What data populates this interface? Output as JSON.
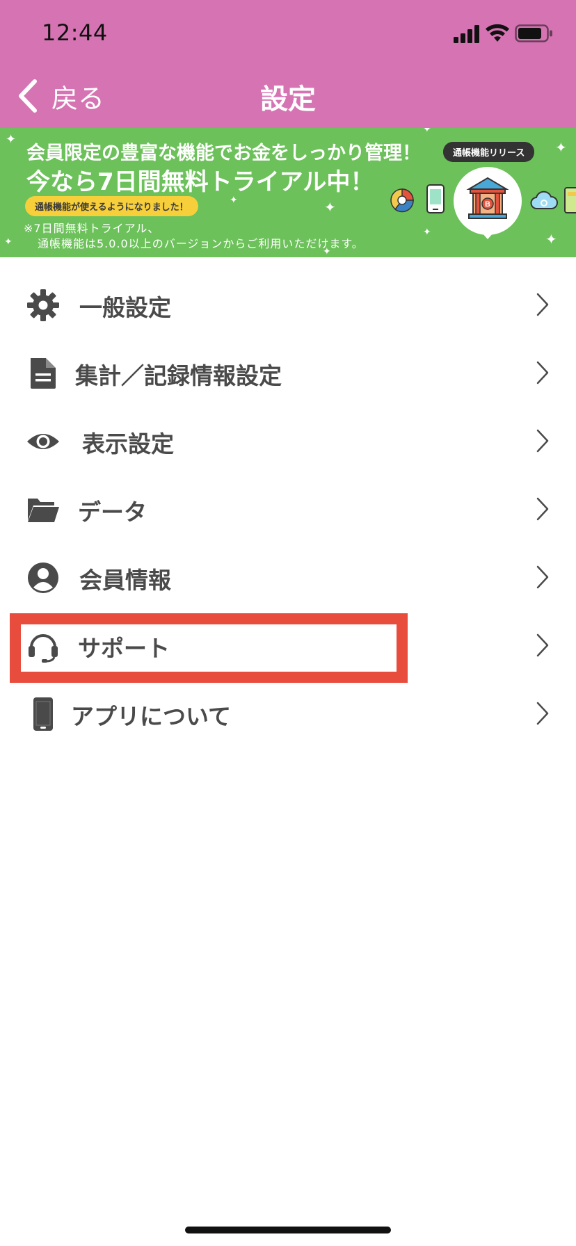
{
  "status_bar": {
    "time": "12:44"
  },
  "nav": {
    "back_label": "戻る",
    "title": "設定"
  },
  "banner": {
    "line1": "会員限定の豊富な機能でお金をしっかり管理！",
    "line2": "今なら7日間無料トライアル中！",
    "pill": "通帳機能が使えるようになりました！",
    "note_line1": "※7日間無料トライアル、",
    "note_line2": "通帳機能は5.0.0以上のバージョンからご利用いただけます。",
    "release_tag": "通帳機能リリース",
    "bank_icon_letter": "B"
  },
  "menu": {
    "items": [
      {
        "label": "一般設定",
        "icon": "gear-icon"
      },
      {
        "label": "集計／記録情報設定",
        "icon": "document-icon"
      },
      {
        "label": "表示設定",
        "icon": "eye-icon"
      },
      {
        "label": "データ",
        "icon": "folder-icon"
      },
      {
        "label": "会員情報",
        "icon": "user-circle-icon"
      },
      {
        "label": "サポート",
        "icon": "headset-icon"
      },
      {
        "label": "アプリについて",
        "icon": "phone-icon"
      }
    ]
  },
  "colors": {
    "header": "#d674b3",
    "banner": "#6cc15a",
    "highlight": "#e84c3d",
    "label": "#4a4a4a"
  }
}
